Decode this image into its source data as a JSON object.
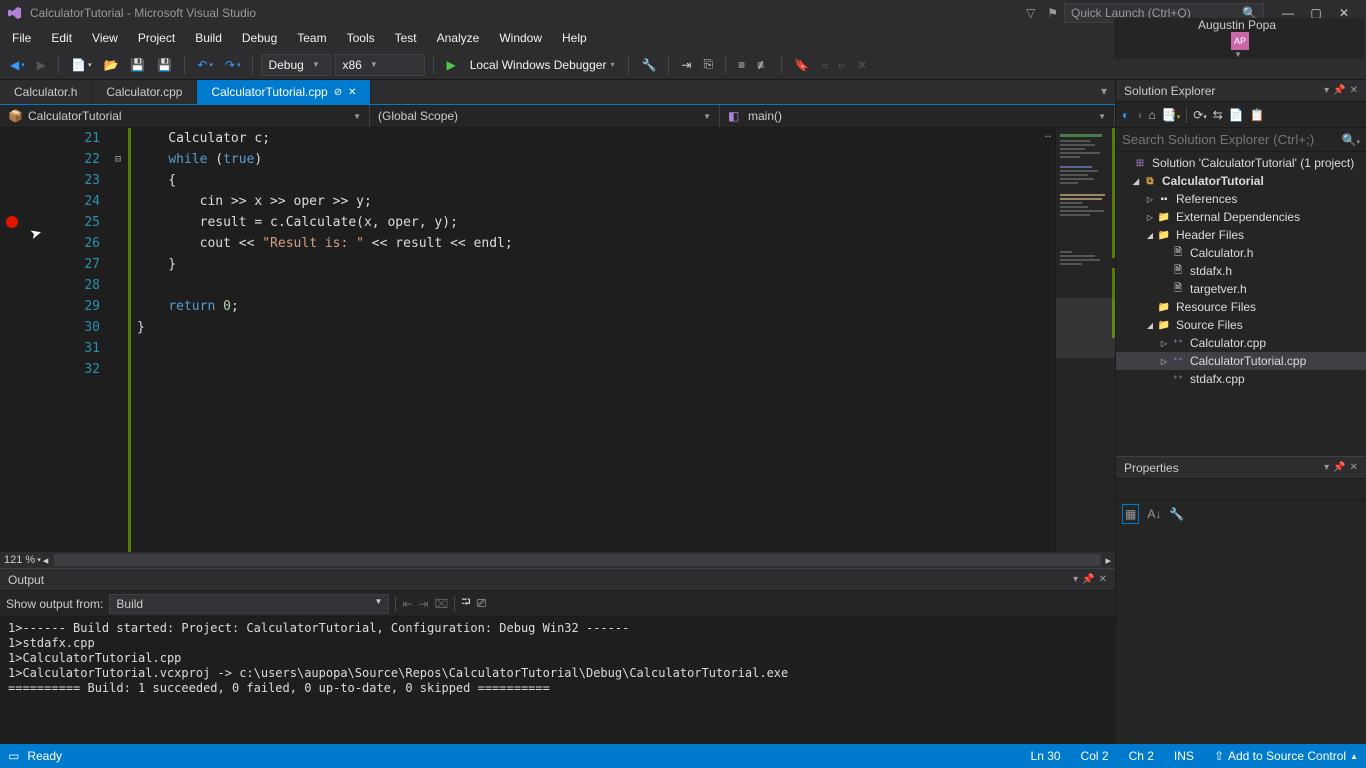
{
  "title": "CalculatorTutorial - Microsoft Visual Studio",
  "quick_launch_placeholder": "Quick Launch (Ctrl+Q)",
  "user_name": "Augustin Popa",
  "user_initials": "AP",
  "menu": [
    "File",
    "Edit",
    "View",
    "Project",
    "Build",
    "Debug",
    "Team",
    "Tools",
    "Test",
    "Analyze",
    "Window",
    "Help"
  ],
  "toolbar": {
    "config": "Debug",
    "platform": "x86",
    "debugger": "Local Windows Debugger"
  },
  "tabs": [
    {
      "label": "Calculator.h",
      "active": false
    },
    {
      "label": "Calculator.cpp",
      "active": false
    },
    {
      "label": "CalculatorTutorial.cpp",
      "active": true
    }
  ],
  "nav": {
    "scope1": "CalculatorTutorial",
    "scope2": "(Global Scope)",
    "scope3": "main()"
  },
  "lines_start": 21,
  "code_lines": [
    {
      "n": 21,
      "html": "    Calculator c;"
    },
    {
      "n": 22,
      "html": "    <span class='kw'>while</span> (<span class='kw'>true</span>)"
    },
    {
      "n": 23,
      "html": "    {"
    },
    {
      "n": 24,
      "html": "        cin >> x >> oper >> y;"
    },
    {
      "n": 25,
      "html": "        result = c.Calculate(x, oper, y);"
    },
    {
      "n": 26,
      "html": "        cout << <span class='str'>\"Result is: \"</span> << result << endl;"
    },
    {
      "n": 27,
      "html": "    }"
    },
    {
      "n": 28,
      "html": ""
    },
    {
      "n": 29,
      "html": "    <span class='kw'>return</span> <span class='num'>0</span>;"
    },
    {
      "n": 30,
      "html": "}"
    },
    {
      "n": 31,
      "html": ""
    },
    {
      "n": 32,
      "html": ""
    }
  ],
  "breakpoint_line": 25,
  "zoom": "121 %",
  "output": {
    "title": "Output",
    "from_label": "Show output from:",
    "from_value": "Build",
    "text": "1>------ Build started: Project: CalculatorTutorial, Configuration: Debug Win32 ------\n1>stdafx.cpp\n1>CalculatorTutorial.cpp\n1>CalculatorTutorial.vcxproj -> c:\\users\\aupopa\\Source\\Repos\\CalculatorTutorial\\Debug\\CalculatorTutorial.exe\n========== Build: 1 succeeded, 0 failed, 0 up-to-date, 0 skipped =========="
  },
  "solution_explorer": {
    "title": "Solution Explorer",
    "search_placeholder": "Search Solution Explorer (Ctrl+;)",
    "solution": "Solution 'CalculatorTutorial' (1 project)",
    "project": "CalculatorTutorial",
    "refs": "References",
    "extdep": "External Dependencies",
    "headers": "Header Files",
    "h1": "Calculator.h",
    "h2": "stdafx.h",
    "h3": "targetver.h",
    "res": "Resource Files",
    "sources": "Source Files",
    "s1": "Calculator.cpp",
    "s2": "CalculatorTutorial.cpp",
    "s3": "stdafx.cpp"
  },
  "properties": {
    "title": "Properties"
  },
  "status": {
    "ready": "Ready",
    "ln": "Ln 30",
    "col": "Col 2",
    "ch": "Ch 2",
    "ins": "INS",
    "source_control": "Add to Source Control"
  }
}
